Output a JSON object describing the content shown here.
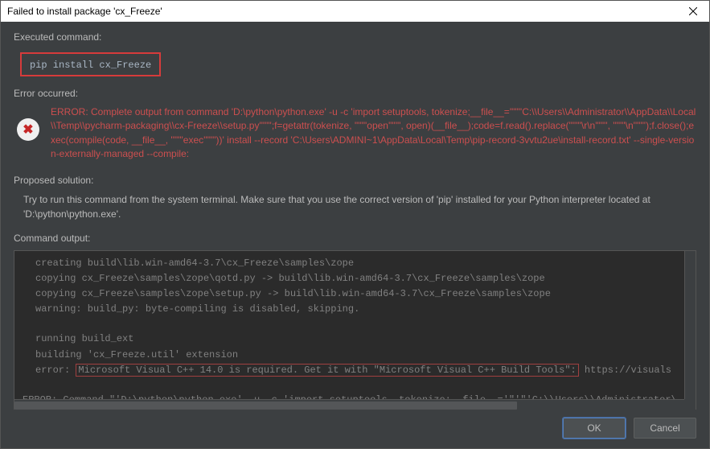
{
  "window": {
    "title": "Failed to install package 'cx_Freeze'"
  },
  "sections": {
    "executed_command_label": "Executed command:",
    "executed_command_value": "pip install cx_Freeze",
    "error_occurred_label": "Error occurred:",
    "error_text": "ERROR: Complete output from command 'D:\\python\\python.exe' -u -c 'import setuptools, tokenize;__file__='\"'\"'C:\\\\Users\\\\Administrator\\\\AppData\\\\Local\\\\Temp\\\\pycharm-packaging\\\\cx-Freeze\\\\setup.py'\"'\"';f=getattr(tokenize, '\"'\"'open'\"'\"', open)(__file__);code=f.read().replace('\"'\"'\\r\\n'\"'\"', '\"'\"'\\n'\"'\"');f.close();exec(compile(code, __file__, '\"'\"'exec'\"'\"'))' install --record 'C:\\Users\\ADMINI~1\\AppData\\Local\\Temp\\pip-record-3vvtu2ue\\install-record.txt' --single-version-externally-managed --compile:",
    "proposed_solution_label": "Proposed solution:",
    "proposed_solution_text": "Try to run this command from the system terminal. Make sure that you use the correct version of 'pip' installed for your Python interpreter located at 'D:\\python\\python.exe'.",
    "command_output_label": "Command output:"
  },
  "output": {
    "line1": "creating build\\lib.win-amd64-3.7\\cx_Freeze\\samples\\zope",
    "line2": "copying cx_Freeze\\samples\\zope\\qotd.py -> build\\lib.win-amd64-3.7\\cx_Freeze\\samples\\zope",
    "line3": "copying cx_Freeze\\samples\\zope\\setup.py -> build\\lib.win-amd64-3.7\\cx_Freeze\\samples\\zope",
    "line4": "warning: build_py: byte-compiling is disabled, skipping.",
    "line5": "running build_ext",
    "line6": "building 'cx_Freeze.util' extension",
    "line7_prefix": "error: ",
    "line7_highlight": "Microsoft Visual C++ 14.0 is required. Get it with \"Microsoft Visual C++ Build Tools\":",
    "line7_suffix": " https://visuals",
    "line8": "ERROR: Command \"'D:\\python\\python.exe' -u -c 'import setuptools, tokenize;__file__='\"'\"'C:\\\\Users\\\\Administrator\\"
  },
  "buttons": {
    "ok": "OK",
    "cancel": "Cancel"
  }
}
